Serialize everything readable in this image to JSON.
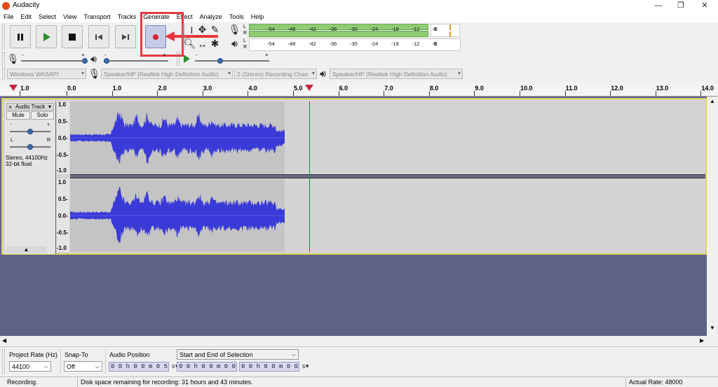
{
  "window": {
    "title": "Audacity"
  },
  "menu": [
    "File",
    "Edit",
    "Select",
    "View",
    "Transport",
    "Tracks",
    "Generate",
    "Effect",
    "Analyze",
    "Tools",
    "Help"
  ],
  "meters": {
    "record_ticks": [
      "-54",
      "-48",
      "-42",
      "-36",
      "-30",
      "-24",
      "-18",
      "-12",
      "-6",
      "0"
    ],
    "play_ticks": [
      "-54",
      "-48",
      "-42",
      "-36",
      "-30",
      "-24",
      "-18",
      "-12",
      "-6",
      "0"
    ],
    "channel_left": "L",
    "channel_right": "R"
  },
  "sliders": {
    "rec_minus": "-",
    "rec_plus": "+",
    "play_minus": "-",
    "play_plus": "+"
  },
  "devices": {
    "host": "Windows WASAPI",
    "recording_device": "Speaker/HP (Realtek High Definition Audio)",
    "channels": "2 (Stereo) Recording Chan",
    "playback_device": "Speaker/HP (Realtek High Definition Audio)"
  },
  "ruler": {
    "labels": [
      "1.0",
      "0.0",
      "1.0",
      "2.0",
      "3.0",
      "4.0",
      "5.0",
      "6.0",
      "7.0",
      "8.0",
      "9.0",
      "10.0",
      "11.0",
      "12.0",
      "13.0",
      "14.0"
    ]
  },
  "track": {
    "name": "Audio Track",
    "close": "×",
    "mute": "Mute",
    "solo": "Solo",
    "gain_minus": "-",
    "gain_plus": "+",
    "pan_left": "L",
    "pan_right": "R",
    "info_line1": "Stereo, 44100Hz",
    "info_line2": "32-bit float",
    "axis_ch1": [
      "1.0",
      "0.5-",
      "0.0-",
      "-0.5-",
      "-1.0"
    ],
    "axis_ch2": [
      "1.0",
      "0.5-",
      "0.0-",
      "-0.5-",
      "-1.0"
    ]
  },
  "bottom": {
    "project_rate_label": "Project Rate (Hz)",
    "project_rate_value": "44100",
    "snap_to_label": "Snap-To",
    "snap_to_value": "Off",
    "audio_position_label": "Audio Position",
    "audio_position_value": "0 0 h 0 0 m 0 5 s",
    "selection_label": "Start and End of Selection",
    "selection_start": "0 0 h 0 0 m 0 0 s",
    "selection_end": "0 0 h 0 0 m 0 0 s"
  },
  "status": {
    "state": "Recording.",
    "disk": "Disk space remaining for recording: 31 hours and 43 minutes.",
    "rate": "Actual Rate: 48000"
  },
  "colors": {
    "waveform": "#3a3ad8",
    "highlight": "#e8383f",
    "cursor": "#c8343c",
    "track_bg": "#5f6284"
  }
}
